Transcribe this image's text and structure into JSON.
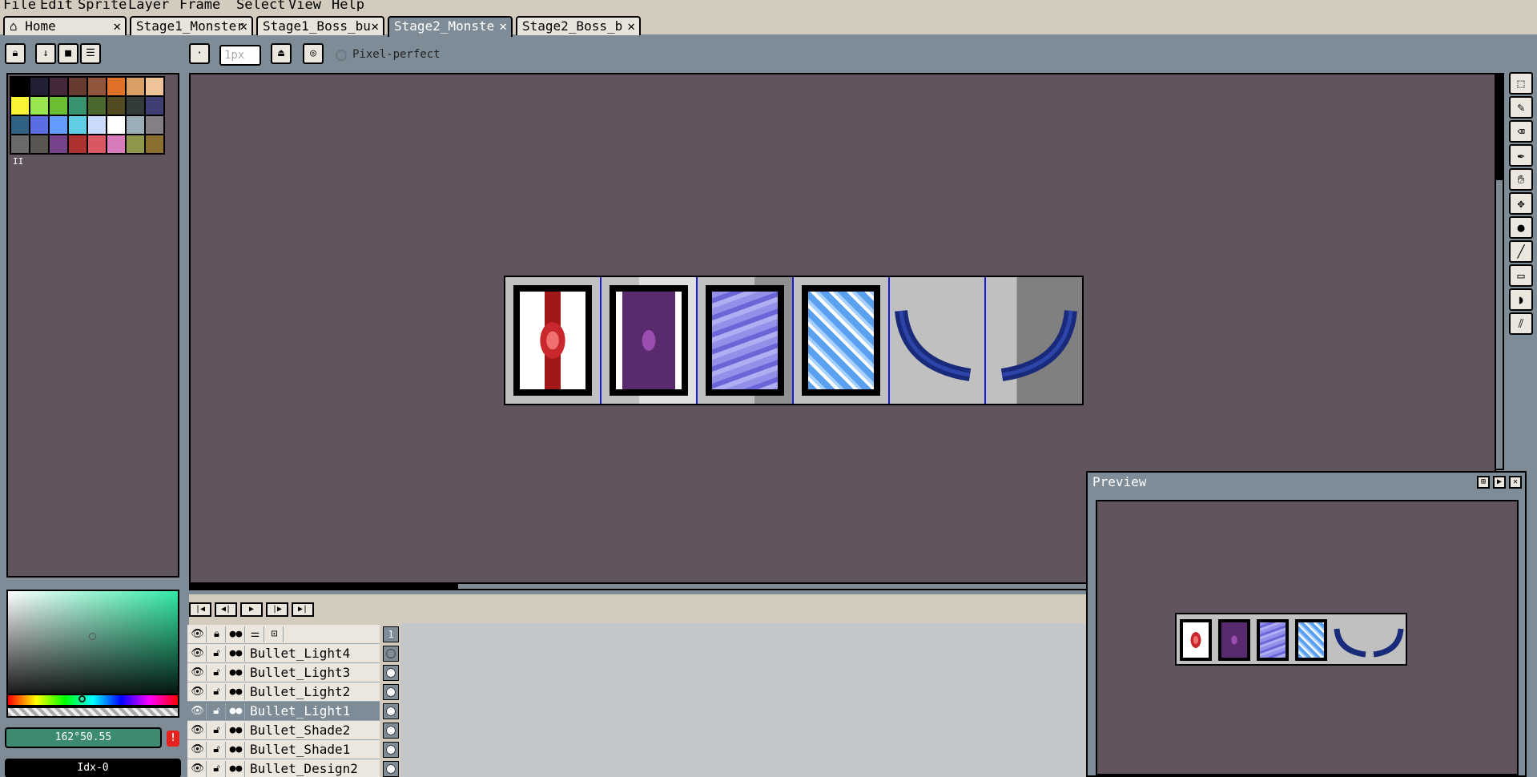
{
  "menu": [
    "File",
    "Edit",
    "Sprite",
    "Layer",
    "Frame",
    "Select",
    "View",
    "Help"
  ],
  "tabs": [
    {
      "label": "Home",
      "icon": "home-icon"
    },
    {
      "label": "Stage1_Monster"
    },
    {
      "label": "Stage1_Boss_bu"
    },
    {
      "label": "Stage2_Monste",
      "active": true
    },
    {
      "label": "Stage2_Boss_b"
    }
  ],
  "toolbar": {
    "brush_size_placeholder": "1px",
    "pixel_perfect_label": "Pixel-perfect"
  },
  "palette": {
    "colors": [
      "#000000",
      "#222034",
      "#45283c",
      "#663931",
      "#8f563b",
      "#df7126",
      "#d9a066",
      "#eec39a",
      "#fbf236",
      "#99e550",
      "#6abe30",
      "#37946e",
      "#4b692f",
      "#524b24",
      "#323c39",
      "#3f3f74",
      "#306082",
      "#5b6ee1",
      "#639bff",
      "#5fcde4",
      "#cbdbfc",
      "#ffffff",
      "#9badb7",
      "#847e87",
      "#696a6a",
      "#595652",
      "#76428a",
      "#ac3232",
      "#d95763",
      "#d77bba",
      "#8f974a",
      "#8a6f30"
    ],
    "indicator": "II"
  },
  "color": {
    "value": "162°50.55",
    "index": "Idx-0",
    "accent": "#33e9a6"
  },
  "layers": [
    {
      "name": "Bullet_Light4"
    },
    {
      "name": "Bullet_Light3"
    },
    {
      "name": "Bullet_Light2"
    },
    {
      "name": "Bullet_Light1",
      "active": true
    },
    {
      "name": "Bullet_Shade2"
    },
    {
      "name": "Bullet_Shade1"
    },
    {
      "name": "Bullet_Design2"
    }
  ],
  "timeline": {
    "frame_number": "1"
  },
  "preview": {
    "title": "Preview"
  },
  "sprite_frames": [
    {
      "type": "card",
      "base": "#ffffff",
      "accent": "#c8282c",
      "highlight": "#f07070"
    },
    {
      "type": "card",
      "base": "#ffffff",
      "accent": "#5a2a6e",
      "highlight": "#9a4fb0"
    },
    {
      "type": "card",
      "base": "#9290e8",
      "accent": "#6a66d8",
      "highlight": "#b0aef2"
    },
    {
      "type": "card",
      "base": "#5aa0f0",
      "accent": "#ffffff",
      "highlight": "#a8d0ff"
    },
    {
      "type": "arc",
      "color": "#1a2a7a",
      "side": "left"
    },
    {
      "type": "arc",
      "color": "#1a2a7a",
      "side": "right"
    }
  ]
}
